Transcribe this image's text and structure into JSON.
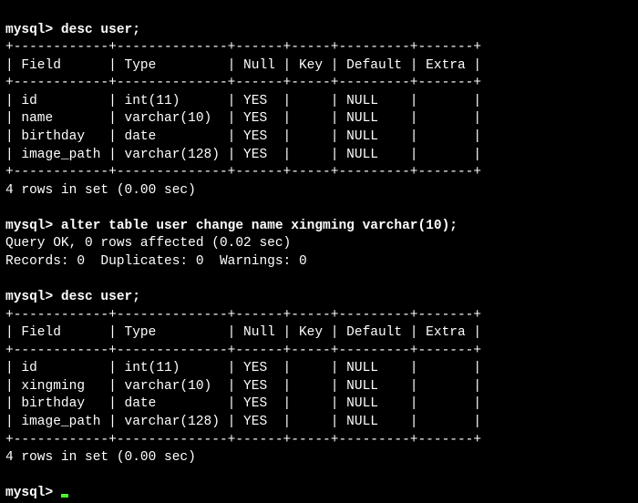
{
  "lines": {
    "0": "mysql> desc user;",
    "1": "4 rows in set (0.00 sec)",
    "2": "mysql> alter table user change name xingming varchar(10);",
    "3": "Query OK, 0 rows affected (0.02 sec)",
    "4": "Records: 0  Duplicates: 0  Warnings: 0",
    "5": "mysql> desc user;",
    "6": "4 rows in set (0.00 sec)",
    "7": "mysql> "
  },
  "table1": {
    "border": "+------------+--------------+------+-----+---------+-------+",
    "header": "| Field      | Type         | Null | Key | Default | Extra |",
    "rows": [
      "| id         | int(11)      | YES  |     | NULL    |       |",
      "| name       | varchar(10)  | YES  |     | NULL    |       |",
      "| birthday   | date         | YES  |     | NULL    |       |",
      "| image_path | varchar(128) | YES  |     | NULL    |       |"
    ]
  },
  "table2": {
    "border": "+------------+--------------+------+-----+---------+-------+",
    "header": "| Field      | Type         | Null | Key | Default | Extra |",
    "rows": [
      "| id         | int(11)      | YES  |     | NULL    |       |",
      "| xingming   | varchar(10)  | YES  |     | NULL    |       |",
      "| birthday   | date         | YES  |     | NULL    |       |",
      "| image_path | varchar(128) | YES  |     | NULL    |       |"
    ]
  },
  "chart_data": {
    "type": "table",
    "tables": [
      {
        "title": "desc user (before)",
        "columns": [
          "Field",
          "Type",
          "Null",
          "Key",
          "Default",
          "Extra"
        ],
        "rows": [
          [
            "id",
            "int(11)",
            "YES",
            "",
            "NULL",
            ""
          ],
          [
            "name",
            "varchar(10)",
            "YES",
            "",
            "NULL",
            ""
          ],
          [
            "birthday",
            "date",
            "YES",
            "",
            "NULL",
            ""
          ],
          [
            "image_path",
            "varchar(128)",
            "YES",
            "",
            "NULL",
            ""
          ]
        ],
        "footer": "4 rows in set (0.00 sec)"
      },
      {
        "title": "desc user (after)",
        "columns": [
          "Field",
          "Type",
          "Null",
          "Key",
          "Default",
          "Extra"
        ],
        "rows": [
          [
            "id",
            "int(11)",
            "YES",
            "",
            "NULL",
            ""
          ],
          [
            "xingming",
            "varchar(10)",
            "YES",
            "",
            "NULL",
            ""
          ],
          [
            "birthday",
            "date",
            "YES",
            "",
            "NULL",
            ""
          ],
          [
            "image_path",
            "varchar(128)",
            "YES",
            "",
            "NULL",
            ""
          ]
        ],
        "footer": "4 rows in set (0.00 sec)"
      }
    ],
    "commands": [
      "desc user;",
      "alter table user change name xingming varchar(10);",
      "desc user;"
    ],
    "alter_result": {
      "message": "Query OK, 0 rows affected (0.02 sec)",
      "records": 0,
      "duplicates": 0,
      "warnings": 0
    }
  }
}
